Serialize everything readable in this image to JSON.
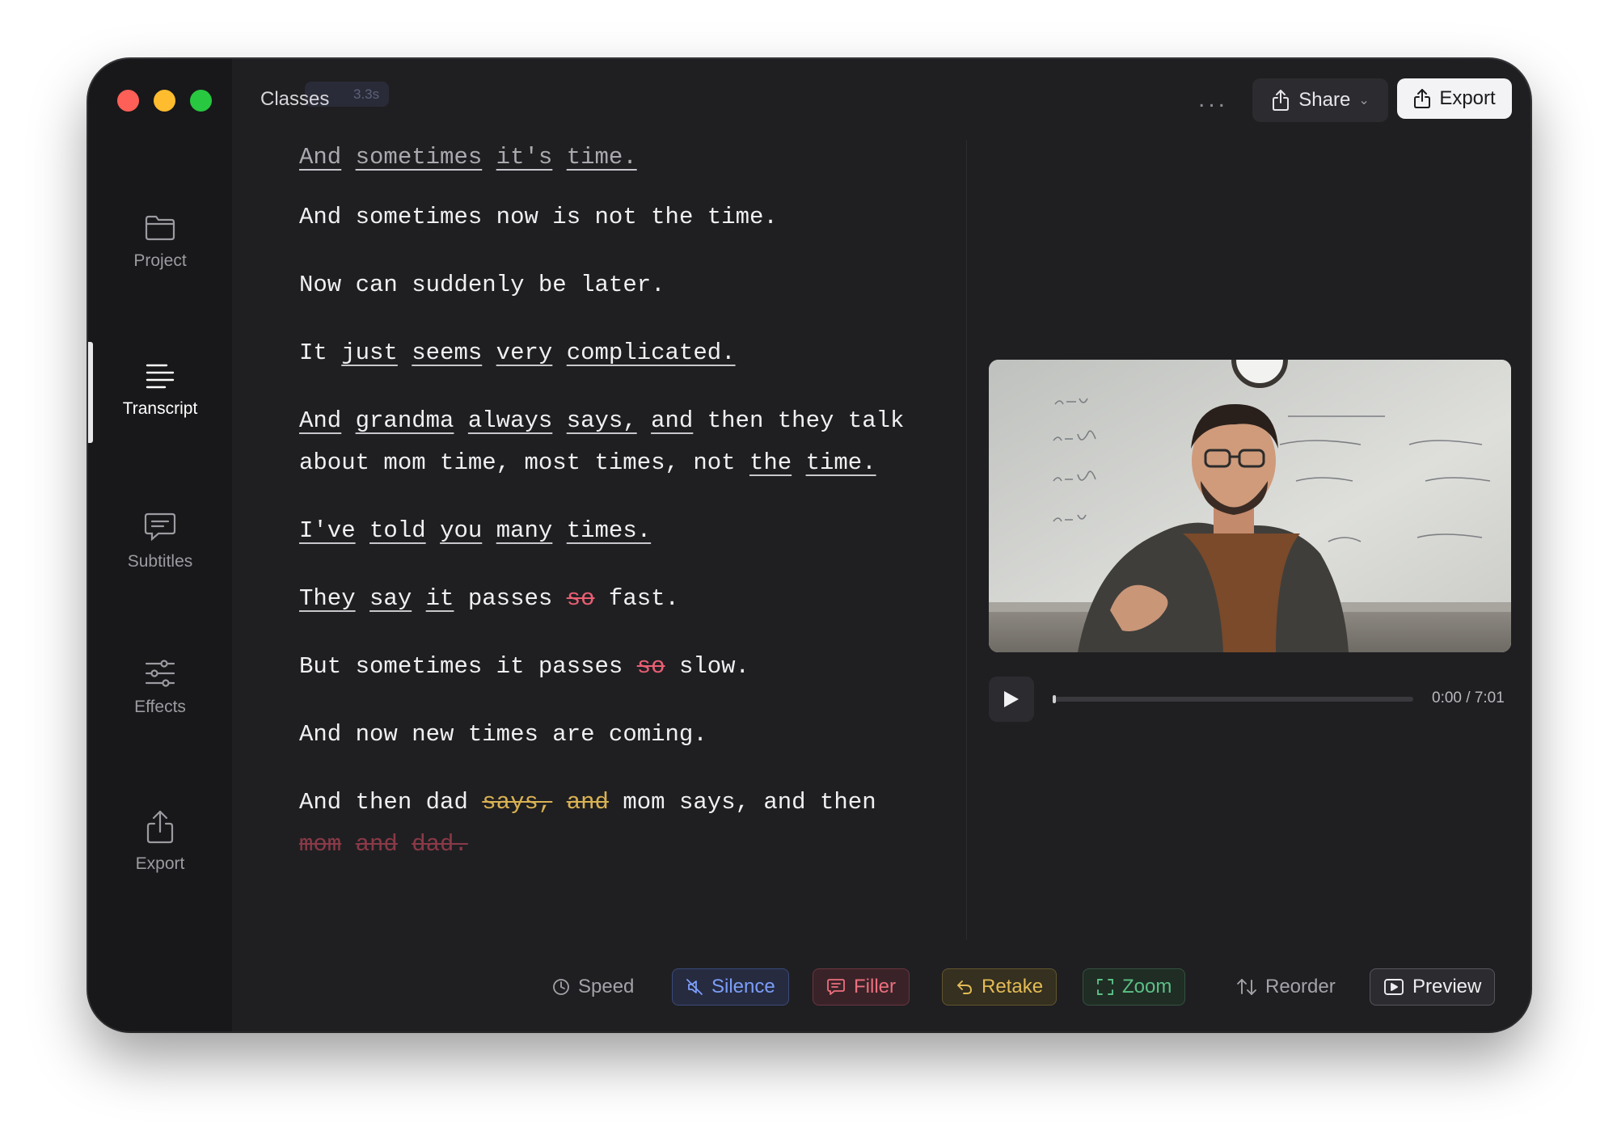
{
  "window": {
    "title": "Classes",
    "ghost_badge": "3.3s"
  },
  "sidebar": {
    "items": [
      {
        "label": "Project",
        "icon": "folder-icon"
      },
      {
        "label": "Transcript",
        "icon": "transcript-lines-icon",
        "active": true
      },
      {
        "label": "Subtitles",
        "icon": "subtitles-chat-icon"
      },
      {
        "label": "Effects",
        "icon": "sliders-icon"
      },
      {
        "label": "Export",
        "icon": "export-upload-icon"
      }
    ]
  },
  "header": {
    "more_label": "...",
    "share_label": "Share",
    "export_label": "Export"
  },
  "transcript": {
    "lines": [
      [
        {
          "t": "And",
          "s": "u-dim"
        },
        {
          "t": "sometimes",
          "s": "u-dim"
        },
        {
          "t": "it's",
          "s": "u-dim"
        },
        {
          "t": "time.",
          "s": "u-dim"
        }
      ],
      [
        {
          "t": "And"
        },
        {
          "t": "sometimes"
        },
        {
          "t": "now"
        },
        {
          "t": "is"
        },
        {
          "t": "not"
        },
        {
          "t": "the"
        },
        {
          "t": "time."
        }
      ],
      [
        {
          "t": "Now"
        },
        {
          "t": "can"
        },
        {
          "t": "suddenly"
        },
        {
          "t": "be"
        },
        {
          "t": "later."
        }
      ],
      [
        {
          "t": "It"
        },
        {
          "t": "just",
          "s": "u"
        },
        {
          "t": "seems",
          "s": "u"
        },
        {
          "t": "very",
          "s": "u"
        },
        {
          "t": "complicated.",
          "s": "u"
        }
      ],
      [
        {
          "t": "And",
          "s": "u"
        },
        {
          "t": "grandma",
          "s": "u"
        },
        {
          "t": "always",
          "s": "u"
        },
        {
          "t": "says,",
          "s": "u"
        },
        {
          "t": "and",
          "s": "u"
        },
        {
          "t": "then"
        },
        {
          "t": "they"
        },
        {
          "t": "talk"
        },
        {
          "t": "about"
        },
        {
          "t": "mom"
        },
        {
          "t": "time,"
        },
        {
          "t": "most"
        },
        {
          "t": "times,"
        },
        {
          "t": "not"
        },
        {
          "t": "the",
          "s": "u"
        },
        {
          "t": "time.",
          "s": "u"
        }
      ],
      [
        {
          "t": "I've",
          "s": "u"
        },
        {
          "t": "told",
          "s": "u"
        },
        {
          "t": "you",
          "s": "u"
        },
        {
          "t": "many",
          "s": "u"
        },
        {
          "t": "times.",
          "s": "u"
        }
      ],
      [
        {
          "t": "They",
          "s": "u"
        },
        {
          "t": "say",
          "s": "u"
        },
        {
          "t": "it",
          "s": "u"
        },
        {
          "t": "passes"
        },
        {
          "t": "so",
          "s": "s-red"
        },
        {
          "t": "fast."
        }
      ],
      [
        {
          "t": "But"
        },
        {
          "t": "sometimes"
        },
        {
          "t": "it"
        },
        {
          "t": "passes"
        },
        {
          "t": "so",
          "s": "s-red"
        },
        {
          "t": "slow."
        }
      ],
      [
        {
          "t": "And"
        },
        {
          "t": "now"
        },
        {
          "t": "new"
        },
        {
          "t": "times"
        },
        {
          "t": "are"
        },
        {
          "t": "coming."
        }
      ],
      [
        {
          "t": "And"
        },
        {
          "t": "then"
        },
        {
          "t": "dad"
        },
        {
          "t": "says,",
          "s": "s-yellow"
        },
        {
          "t": "and",
          "s": "s-yellow"
        },
        {
          "t": "mom"
        },
        {
          "t": "says,"
        },
        {
          "t": "and"
        },
        {
          "t": "then"
        },
        {
          "t": "mom",
          "s": "s-dim"
        },
        {
          "t": "and",
          "s": "s-dim"
        },
        {
          "t": "dad.",
          "s": "s-dim"
        }
      ]
    ]
  },
  "player": {
    "time_label": "0:00 / 7:01",
    "progress_fraction": 0.0
  },
  "toolbar": {
    "speed_label": "Speed",
    "silence_label": "Silence",
    "filler_label": "Filler",
    "retake_label": "Retake",
    "zoom_label": "Zoom",
    "reorder_label": "Reorder",
    "preview_label": "Preview"
  },
  "colors": {
    "accent_silence": "#7c9ef8",
    "accent_filler": "#ec6f7e",
    "accent_retake": "#e3bb56",
    "accent_zoom": "#5cc085"
  }
}
